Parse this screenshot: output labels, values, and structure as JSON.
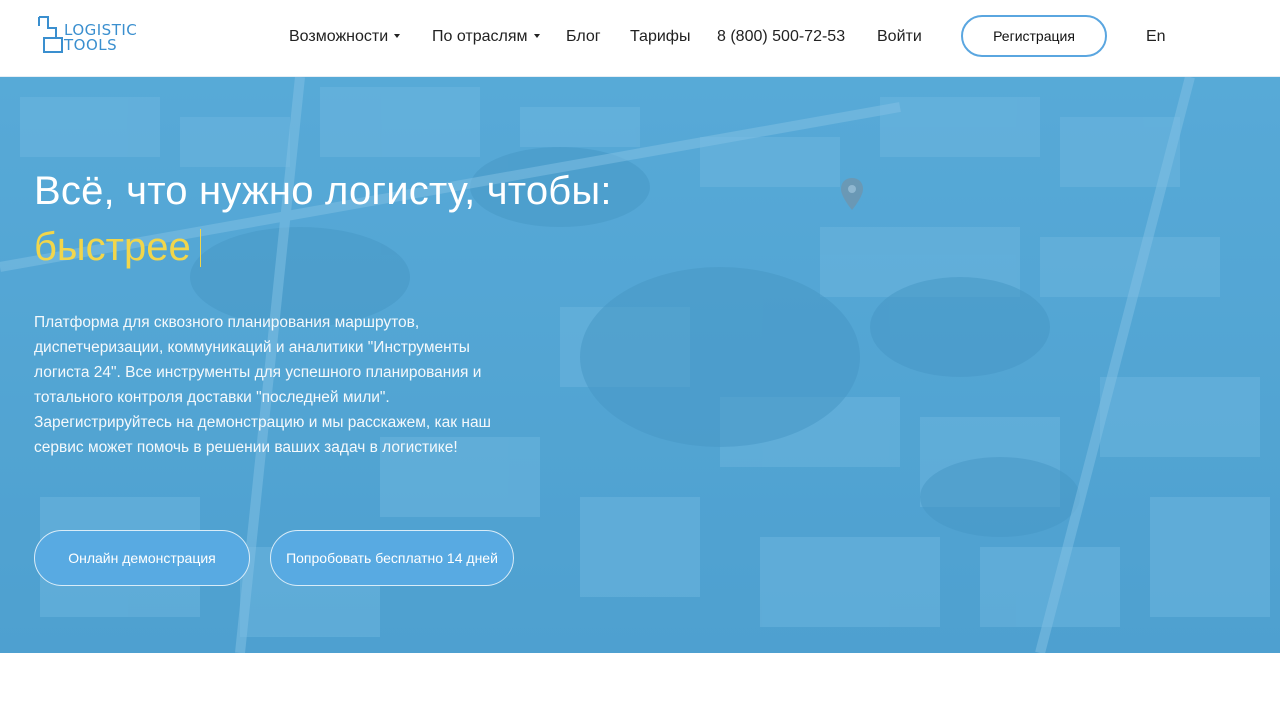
{
  "header": {
    "logo": {
      "line1": "LOGISTIC",
      "line2": "TOOLS"
    },
    "nav": [
      {
        "label": "Возможности",
        "dropdown": true
      },
      {
        "label": "По отраслям",
        "dropdown": true
      },
      {
        "label": "Блог",
        "dropdown": false
      },
      {
        "label": "Тарифы",
        "dropdown": false
      },
      {
        "label": "8 (800) 500-72-53",
        "dropdown": false
      },
      {
        "label": "Войти",
        "dropdown": false
      }
    ],
    "register_label": "Регистрация",
    "language_label": "En"
  },
  "hero": {
    "headline": "Всё, что нужно логисту, чтобы:",
    "rotating_word": "быстрее",
    "description": "Платформа для сквозного планирования маршрутов, диспетчеризации, коммуникаций и аналитики \"Инструменты логиста 24\". Все инструменты для успешного планирования и тотального контроля доставки \"последней мили\". Зарегистрируйтесь на демонстрацию и мы расскажем, как наш сервис может помочь в решении ваших задач в логистике!",
    "demo_button": "Онлайн демонстрация",
    "trial_button": "Попробовать бесплатно 14 дней"
  },
  "colors": {
    "accent": "#5aa6e0",
    "highlight": "#f2d64b",
    "hero_tint": "#4b9fcc",
    "logo": "#3a8fcf"
  },
  "icons": {
    "logo": "logistic-tools-logo-icon",
    "caret": "caret-down-icon",
    "pin": "map-pin-icon"
  }
}
